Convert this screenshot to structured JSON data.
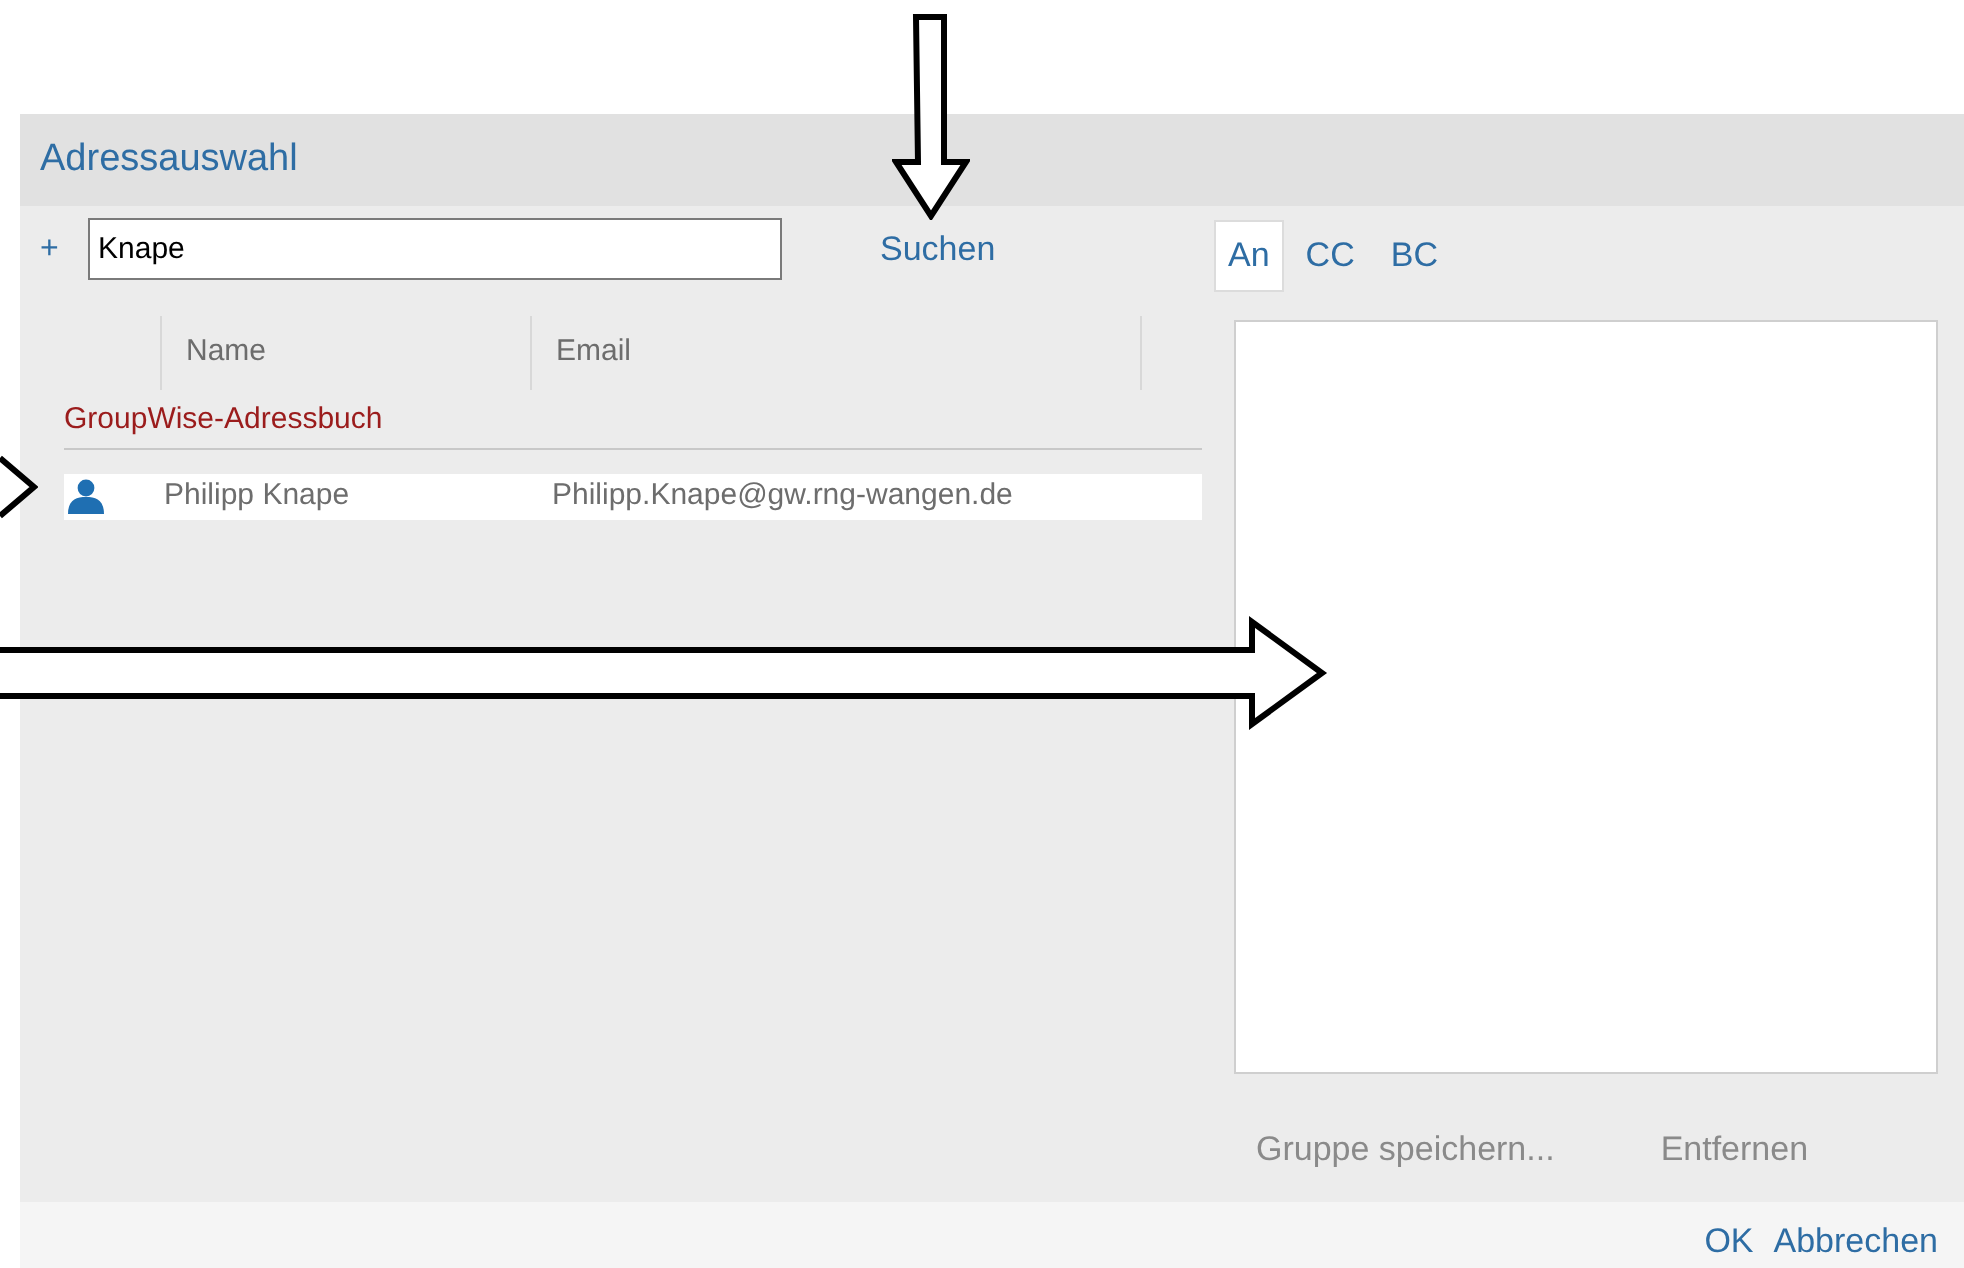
{
  "window": {
    "title": "Adressauswahl"
  },
  "search": {
    "add_label": "+",
    "value": "Knape",
    "button": "Suchen"
  },
  "table": {
    "columns": [
      "Name",
      "Email"
    ],
    "groups": [
      {
        "title": "GroupWise-Adressbuch",
        "rows": [
          {
            "kind": "person",
            "name": "Philipp Knape",
            "email": "Philipp.Knape@gw.rng-wangen.de",
            "selected": true
          }
        ]
      }
    ]
  },
  "tabs": [
    {
      "label": "An",
      "selected": true
    },
    {
      "label": "CC",
      "selected": false
    },
    {
      "label": "BC",
      "selected": false
    }
  ],
  "actions": [
    {
      "label": "Gruppe speichern...",
      "disabled": true
    },
    {
      "label": "Entfernen",
      "disabled": true
    }
  ],
  "footer_buttons": [
    "OK",
    "Abbrechen"
  ]
}
